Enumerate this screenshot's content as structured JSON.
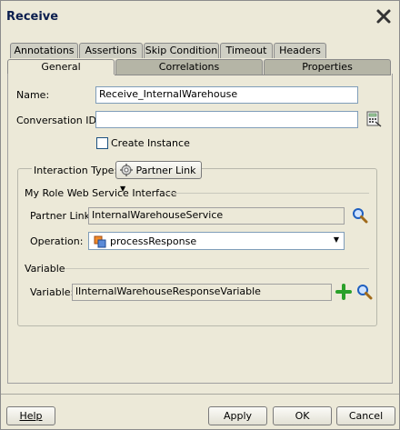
{
  "dialog": {
    "title": "Receive"
  },
  "tabs": {
    "back_row": [
      "Annotations",
      "Assertions",
      "Skip Condition",
      "Timeout",
      "Headers"
    ],
    "front_row": [
      "General",
      "Correlations",
      "Properties"
    ],
    "selected": "General"
  },
  "general": {
    "name_label": "Name:",
    "name_value": "Receive_InternalWarehouse",
    "conversation_label": "Conversation ID:",
    "conversation_value": "",
    "create_instance_label": "Create Instance",
    "create_instance_checked": false,
    "interaction_type_label": "Interaction Type:",
    "interaction_type_value": "Partner Link",
    "my_role_heading": "My Role Web Service Interface",
    "partner_link_label": "Partner Link:",
    "partner_link_value": "InternalWarehouseService",
    "operation_label": "Operation:",
    "operation_value": "processResponse",
    "variable_heading": "Variable",
    "variable_label": "Variable:",
    "variable_value": "lInternalWarehouseResponseVariable"
  },
  "buttons": {
    "help": "Help",
    "apply": "Apply",
    "ok": "OK",
    "cancel": "Cancel"
  },
  "icons": {
    "close": "close-x-icon",
    "expression_builder": "expression-builder-icon",
    "search": "magnifier-icon",
    "add": "add-plus-icon",
    "partner_link": "partner-link-gear-icon",
    "operation": "operation-icon"
  },
  "colors": {
    "title": "#0b1e4e",
    "add_icon": "#2aa02a",
    "search_icon": "#1f5fbf"
  }
}
